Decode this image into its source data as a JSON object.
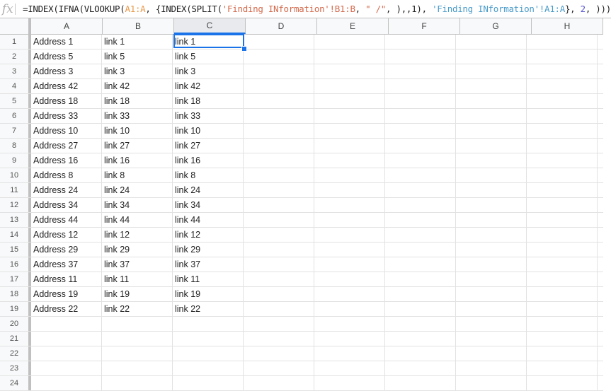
{
  "formula_bar": {
    "fx_label": "fx",
    "formula_parts": [
      {
        "text": "=INDEX(IFNA(VLOOKUP(",
        "type": "plain"
      },
      {
        "text": "A1:A",
        "type": "ref1"
      },
      {
        "text": ", {INDEX(SPLIT(",
        "type": "plain"
      },
      {
        "text": "'Finding INformation'!B1:B",
        "type": "str"
      },
      {
        "text": ", ",
        "type": "plain"
      },
      {
        "text": "\" /\"",
        "type": "str"
      },
      {
        "text": ", ),,1), ",
        "type": "plain"
      },
      {
        "text": "'Finding INformation'!A1:A",
        "type": "ref2"
      },
      {
        "text": "}, ",
        "type": "plain"
      },
      {
        "text": "2",
        "type": "num"
      },
      {
        "text": ", )))",
        "type": "plain"
      }
    ]
  },
  "columns": [
    "A",
    "B",
    "C",
    "D",
    "E",
    "F",
    "G",
    "H"
  ],
  "selected_column": "C",
  "selected_cell": "C1",
  "rows": [
    {
      "num": "1",
      "cells": [
        "Address 1",
        "link 1",
        "link 1"
      ]
    },
    {
      "num": "2",
      "cells": [
        "Address 5",
        "link 5",
        "link 5"
      ]
    },
    {
      "num": "3",
      "cells": [
        "Address 3",
        "link 3",
        "link 3"
      ]
    },
    {
      "num": "4",
      "cells": [
        "Address 42",
        "link 42",
        "link 42"
      ]
    },
    {
      "num": "5",
      "cells": [
        "Address 18",
        "link 18",
        "link 18"
      ]
    },
    {
      "num": "6",
      "cells": [
        "Address 33",
        "link 33",
        "link 33"
      ]
    },
    {
      "num": "7",
      "cells": [
        "Address 10",
        "link 10",
        "link 10"
      ]
    },
    {
      "num": "8",
      "cells": [
        "Address 27",
        "link 27",
        "link 27"
      ]
    },
    {
      "num": "9",
      "cells": [
        "Address 16",
        "link 16",
        "link 16"
      ]
    },
    {
      "num": "10",
      "cells": [
        "Address 8",
        "link 8",
        "link 8"
      ]
    },
    {
      "num": "11",
      "cells": [
        "Address 24",
        "link 24",
        "link 24"
      ]
    },
    {
      "num": "12",
      "cells": [
        "Address 34",
        "link 34",
        "link 34"
      ]
    },
    {
      "num": "13",
      "cells": [
        "Address 44",
        "link 44",
        "link 44"
      ]
    },
    {
      "num": "14",
      "cells": [
        "Address 12",
        "link 12",
        "link 12"
      ]
    },
    {
      "num": "15",
      "cells": [
        "Address 29",
        "link 29",
        "link 29"
      ]
    },
    {
      "num": "16",
      "cells": [
        "Address 37",
        "link 37",
        "link 37"
      ]
    },
    {
      "num": "17",
      "cells": [
        "Address 11",
        "link 11",
        "link 11"
      ]
    },
    {
      "num": "18",
      "cells": [
        "Address 19",
        "link 19",
        "link 19"
      ]
    },
    {
      "num": "19",
      "cells": [
        "Address 22",
        "link 22",
        "link 22"
      ]
    },
    {
      "num": "20",
      "cells": [
        "",
        "",
        ""
      ]
    },
    {
      "num": "21",
      "cells": [
        "",
        "",
        ""
      ]
    },
    {
      "num": "22",
      "cells": [
        "",
        "",
        ""
      ]
    },
    {
      "num": "23",
      "cells": [
        "",
        "",
        ""
      ]
    },
    {
      "num": "24",
      "cells": [
        "",
        "",
        ""
      ]
    }
  ]
}
